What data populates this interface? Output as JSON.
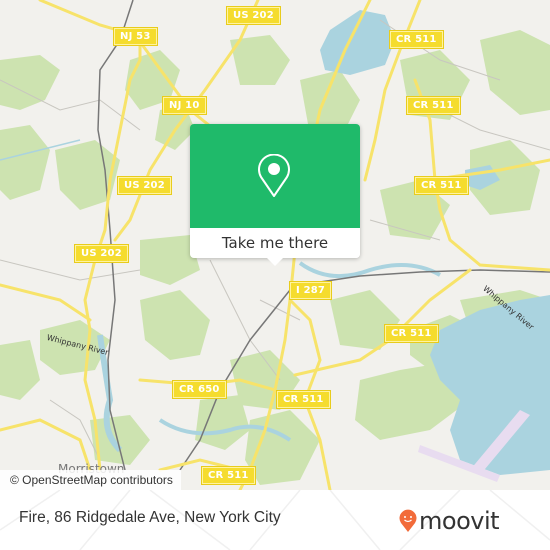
{
  "map": {
    "colors": {
      "background": "#f2f1ed",
      "forest": "#cde3b0",
      "water": "#aad3df",
      "road": "#f7e36a",
      "runway": "#e8dcf0",
      "rail": "#777777"
    },
    "shields": [
      {
        "id": "us-202-top",
        "label": "US 202"
      },
      {
        "id": "nj-53",
        "label": "NJ 53"
      },
      {
        "id": "cr-511-top",
        "label": "CR 511"
      },
      {
        "id": "nj-10",
        "label": "NJ 10"
      },
      {
        "id": "cr-511-mid",
        "label": "CR 511"
      },
      {
        "id": "us-202-mid",
        "label": "US 202"
      },
      {
        "id": "cr-511-right",
        "label": "CR 511"
      },
      {
        "id": "us-202-left",
        "label": "US 202"
      },
      {
        "id": "i-287",
        "label": "I 287"
      },
      {
        "id": "cr-511-east",
        "label": "CR 511"
      },
      {
        "id": "cr-650",
        "label": "CR 650"
      },
      {
        "id": "cr-511-south",
        "label": "CR 511"
      },
      {
        "id": "cr-511-bottom",
        "label": "CR 511"
      }
    ],
    "place_labels": [
      {
        "id": "morristown",
        "label": "Morristown"
      }
    ],
    "river_labels": [
      {
        "id": "whippany-river-west",
        "label": "Whippany River"
      },
      {
        "id": "whippany-river-east",
        "label": "Whippany River"
      }
    ],
    "attribution": "© OpenStreetMap contributors"
  },
  "popup": {
    "icon": "map-pin-icon",
    "button_label": "Take me there",
    "color": "#1fba6a"
  },
  "footer": {
    "address": "Fire, 86 Ridgedale Ave, New York City",
    "logo": {
      "wordmark": "moovit",
      "icon": "moovit-smiley-pin-icon",
      "color": "#f26b3a"
    }
  }
}
